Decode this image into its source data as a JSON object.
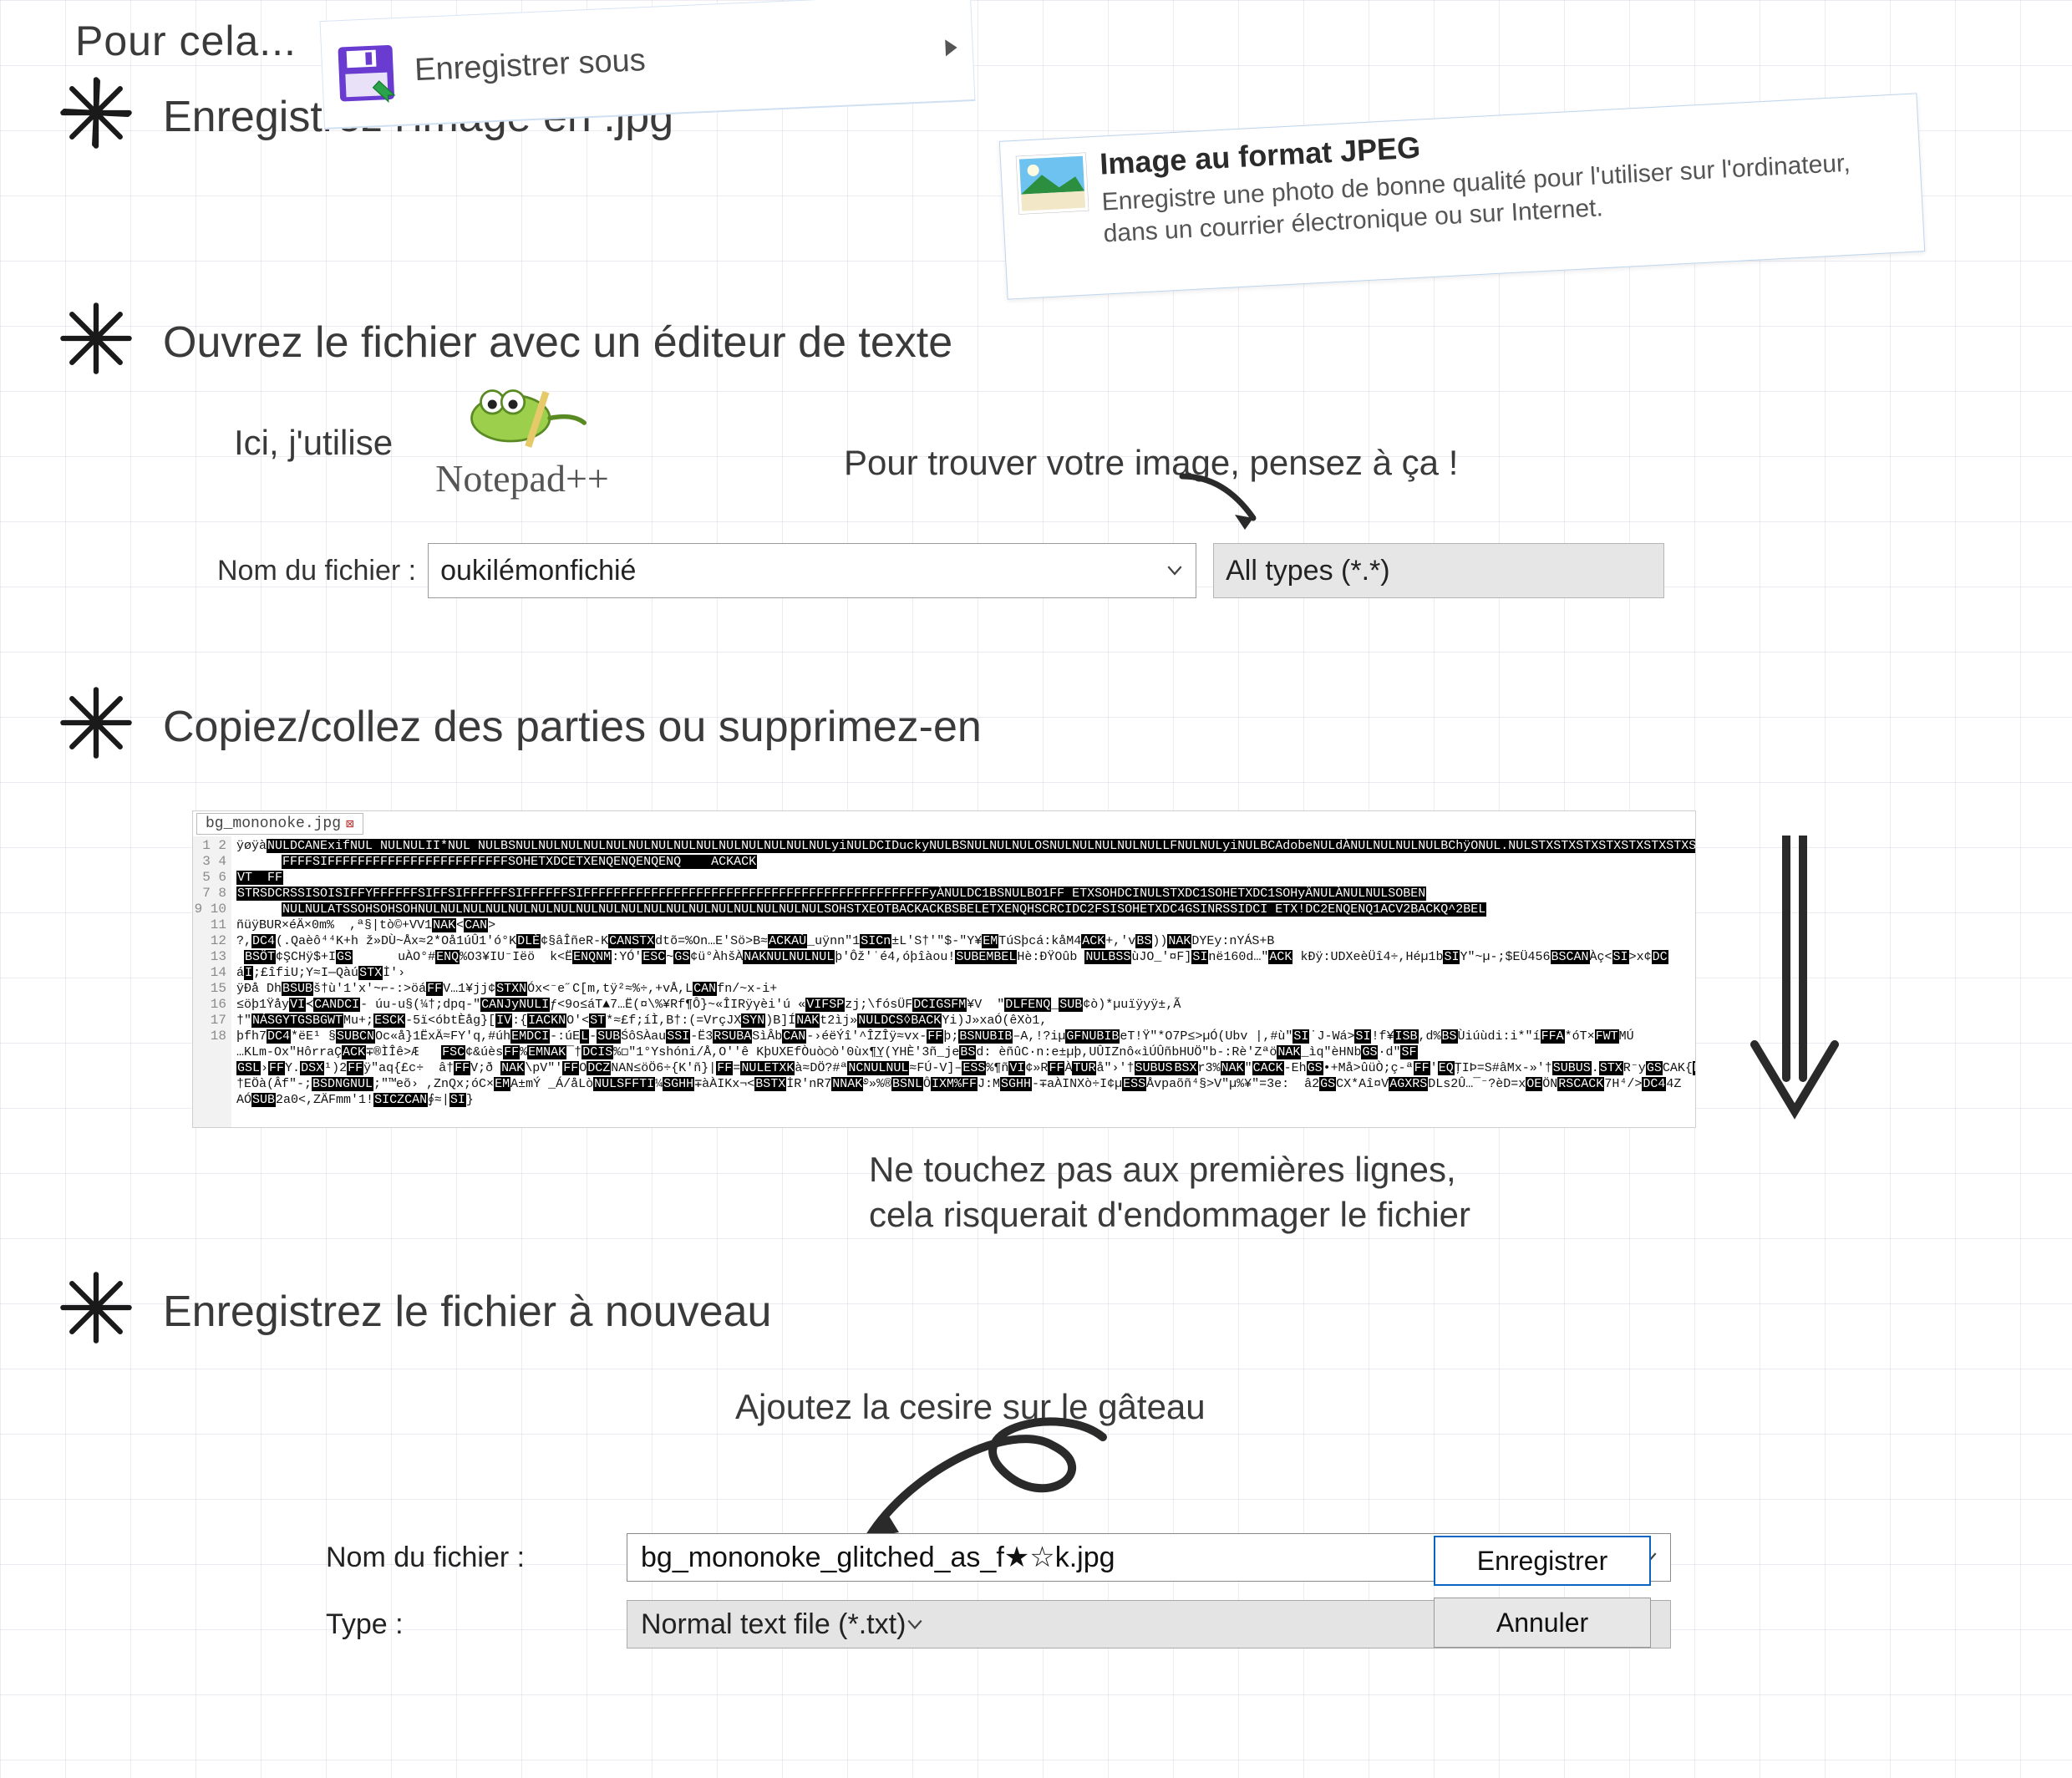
{
  "intro": "Pour cela...",
  "steps": {
    "s1": "Enregistrez l'image en .jpg",
    "s2": "Ouvrez le fichier avec un éditeur de texte",
    "s3": "Copiez/collez des parties ou supprimez-en",
    "s4": "Enregistrez le fichier à nouveau"
  },
  "saveas": {
    "label": "Enregistrer sous"
  },
  "flyout": {
    "title": "Image au format JPEG",
    "desc": "Enregistre une photo de bonne qualité pour l'utiliser sur l'ordinateur, dans un courrier électronique ou sur Internet."
  },
  "npp": {
    "intro": "Ici, j'utilise",
    "name": "Notepad++"
  },
  "hint_types": "Pour trouver votre image, pensez à ça !",
  "filerow1": {
    "label": "Nom du fichier :",
    "value": "oukilémonfichié",
    "type": "All types (*.*)"
  },
  "editor": {
    "tab": "bg_mononoke.jpg",
    "lines": [
      "1",
      "2",
      "3",
      "4",
      "5",
      "6",
      "7",
      "8",
      "9",
      "10",
      "11",
      "12",
      "13",
      "14",
      "15",
      "16",
      "17",
      "18"
    ],
    "snippets": {
      "l1a": "ÿøÿà",
      "l1b": "NULDCANExifNUL NULNULII*NUL NULBSNULNULNULNULNULNULNULNULNULNULNULNULNULNULyiNULDCIDuckyNULBSNULNULNULOSNULNULNULNULNULLFNULNULyiNULBCAdobeNULdÀNULNULNULNULBChÿONUL.NULSTXSTXSTXSTXSTXSTXSTXSTX",
      "l2": "FFFFSIFFFFFFFFFFFFFFFFFFFFFFFFSOHETXDCETXENQENQENQENQ    ACKACK",
      "l3": "VT  FF",
      "l4": "STRSDCRSSISOISIFFYFFFFFFSIFFSIFFFFFFSIFFFFFFSIFFFFFFFFFFFFFFFFFFFFFFFFFFFFFFFFFFFFFFFFFFFFFFyÀNULDC1BSNULBO1FF ETXSOHDCINULSTXDC1SOHETXDC1SOHyÄNULÀNULNULSOBEN",
      "l5": "NULNULATSSOHSOHSOHNULNULNULNULNULNULNULNULNULNULNULNULNULNULNULNULNULNULSOHSTXEOTBACKACKBSBELETXENQHSCRCIDC2FSISOHETXDC4GSINRSSIDCI ETX!DC2ENQENQ1ACV2BACKQ^2BEL",
      "l6": "ñüÿBUR×éÄ×0m%"
    },
    "caption1": "Ne touchez pas aux premières lignes,",
    "caption2": "cela risquerait d'endommager le fichier"
  },
  "cherry": "Ajoutez la cesire sur le gâteau",
  "savedlg": {
    "name_label": "Nom du fichier :",
    "name_value": "bg_mononoke_glitched_as_f★☆k.jpg",
    "type_label": "Type :",
    "type_value": "Normal text file (*.txt)",
    "save": "Enregistrer",
    "cancel": "Annuler"
  }
}
